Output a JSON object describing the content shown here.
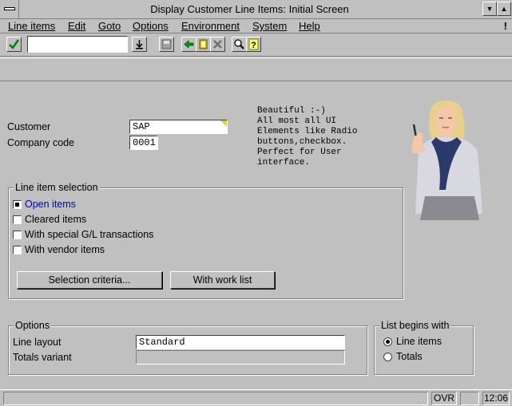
{
  "window": {
    "title": "Display Customer Line Items: Initial Screen"
  },
  "menu": {
    "items": [
      {
        "label": "Line items"
      },
      {
        "label": "Edit"
      },
      {
        "label": "Goto"
      },
      {
        "label": "Options"
      },
      {
        "label": "Environment"
      },
      {
        "label": "System"
      },
      {
        "label": "Help"
      }
    ],
    "extra": "!"
  },
  "toolbar": {
    "command_value": "",
    "icons": [
      "enter-icon",
      "dropdown-icon",
      "save-icon",
      "back-icon",
      "exit-icon",
      "cancel-icon",
      "find-icon",
      "help-icon"
    ]
  },
  "form": {
    "customer_label": "Customer",
    "customer_value": "SAP",
    "company_label": "Company code",
    "company_value": "0001"
  },
  "note": "Beautiful :-)\nAll most all UI\nElements like Radio\nbuttons,checkbox.\nPerfect for User\ninterface.",
  "line_item_selection": {
    "title": "Line item selection",
    "options": [
      {
        "label": "Open items",
        "checked": true
      },
      {
        "label": "Cleared items",
        "checked": false
      },
      {
        "label": "With special G/L transactions",
        "checked": false
      },
      {
        "label": "With vendor items",
        "checked": false
      }
    ],
    "selection_button": "Selection criteria...",
    "worklist_button": "With work list"
  },
  "options": {
    "title": "Options",
    "line_layout_label": "Line layout",
    "line_layout_value": "Standard",
    "totals_label": "Totals variant",
    "totals_value": ""
  },
  "list_begins": {
    "title": "List begins with",
    "options": [
      {
        "label": "Line items",
        "selected": true
      },
      {
        "label": "Totals",
        "selected": false
      }
    ]
  },
  "status": {
    "mode": "OVR",
    "time": "12:06"
  },
  "colors": {
    "background": "#c0c0c0",
    "highlight": "#0000c0",
    "required": "#e8d800"
  }
}
